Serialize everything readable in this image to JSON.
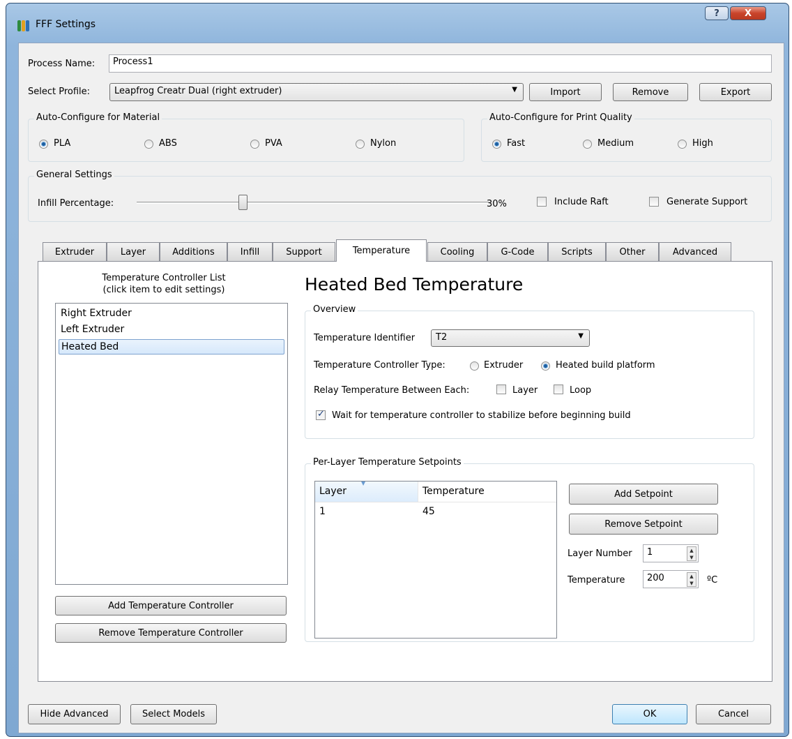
{
  "window": {
    "title": "FFF Settings",
    "help_label": "?",
    "close_label": "X"
  },
  "process": {
    "label": "Process Name:",
    "value": "Process1"
  },
  "profile": {
    "label": "Select Profile:",
    "selected": "Leapfrog Creatr Dual (right extruder)",
    "import_label": "Import",
    "remove_label": "Remove",
    "export_label": "Export"
  },
  "material": {
    "title": "Auto-Configure for Material",
    "options": [
      {
        "label": "PLA",
        "checked": true
      },
      {
        "label": "ABS",
        "checked": false
      },
      {
        "label": "PVA",
        "checked": false
      },
      {
        "label": "Nylon",
        "checked": false
      }
    ]
  },
  "quality": {
    "title": "Auto-Configure for Print Quality",
    "options": [
      {
        "label": "Fast",
        "checked": true
      },
      {
        "label": "Medium",
        "checked": false
      },
      {
        "label": "High",
        "checked": false
      }
    ]
  },
  "general": {
    "title": "General Settings",
    "infill_label": "Infill Percentage:",
    "infill_value": "30%",
    "infill_fraction": 0.3,
    "include_raft_label": "Include Raft",
    "include_raft": false,
    "generate_support_label": "Generate Support",
    "generate_support": false
  },
  "tabs": [
    {
      "label": "Extruder"
    },
    {
      "label": "Layer"
    },
    {
      "label": "Additions"
    },
    {
      "label": "Infill"
    },
    {
      "label": "Support"
    },
    {
      "label": "Temperature",
      "active": true
    },
    {
      "label": "Cooling"
    },
    {
      "label": "G-Code"
    },
    {
      "label": "Scripts"
    },
    {
      "label": "Other"
    },
    {
      "label": "Advanced"
    }
  ],
  "controllers": {
    "title_line1": "Temperature Controller List",
    "title_line2": "(click item to edit settings)",
    "items": [
      {
        "label": "Right Extruder"
      },
      {
        "label": "Left Extruder"
      },
      {
        "label": "Heated Bed",
        "selected": true
      }
    ],
    "add_label": "Add Temperature Controller",
    "remove_label": "Remove Temperature Controller"
  },
  "heading": "Heated Bed Temperature",
  "overview": {
    "title": "Overview",
    "identifier_label": "Temperature Identifier",
    "identifier_value": "T2",
    "type_label": "Temperature Controller Type:",
    "type_extruder": "Extruder",
    "type_platform": "Heated build platform",
    "type_selected": "platform",
    "relay_label": "Relay Temperature Between Each:",
    "relay_layer": "Layer",
    "relay_loop": "Loop",
    "wait_label": "Wait for temperature controller to stabilize before beginning build",
    "wait_checked": true
  },
  "setpoints": {
    "title": "Per-Layer Temperature Setpoints",
    "columns": [
      "Layer",
      "Temperature"
    ],
    "rows": [
      [
        "1",
        "45"
      ]
    ],
    "add_label": "Add Setpoint",
    "remove_label": "Remove Setpoint",
    "layer_number_label": "Layer Number",
    "layer_number_value": "1",
    "temperature_label": "Temperature",
    "temperature_value": "200",
    "temperature_unit": "ºC"
  },
  "footer": {
    "hide_advanced": "Hide Advanced",
    "select_models": "Select Models",
    "ok": "OK",
    "cancel": "Cancel"
  },
  "colors": {
    "title_bar": "#8fb5dc",
    "accent": "#1f5f9f",
    "close_button": "#c9442b"
  }
}
